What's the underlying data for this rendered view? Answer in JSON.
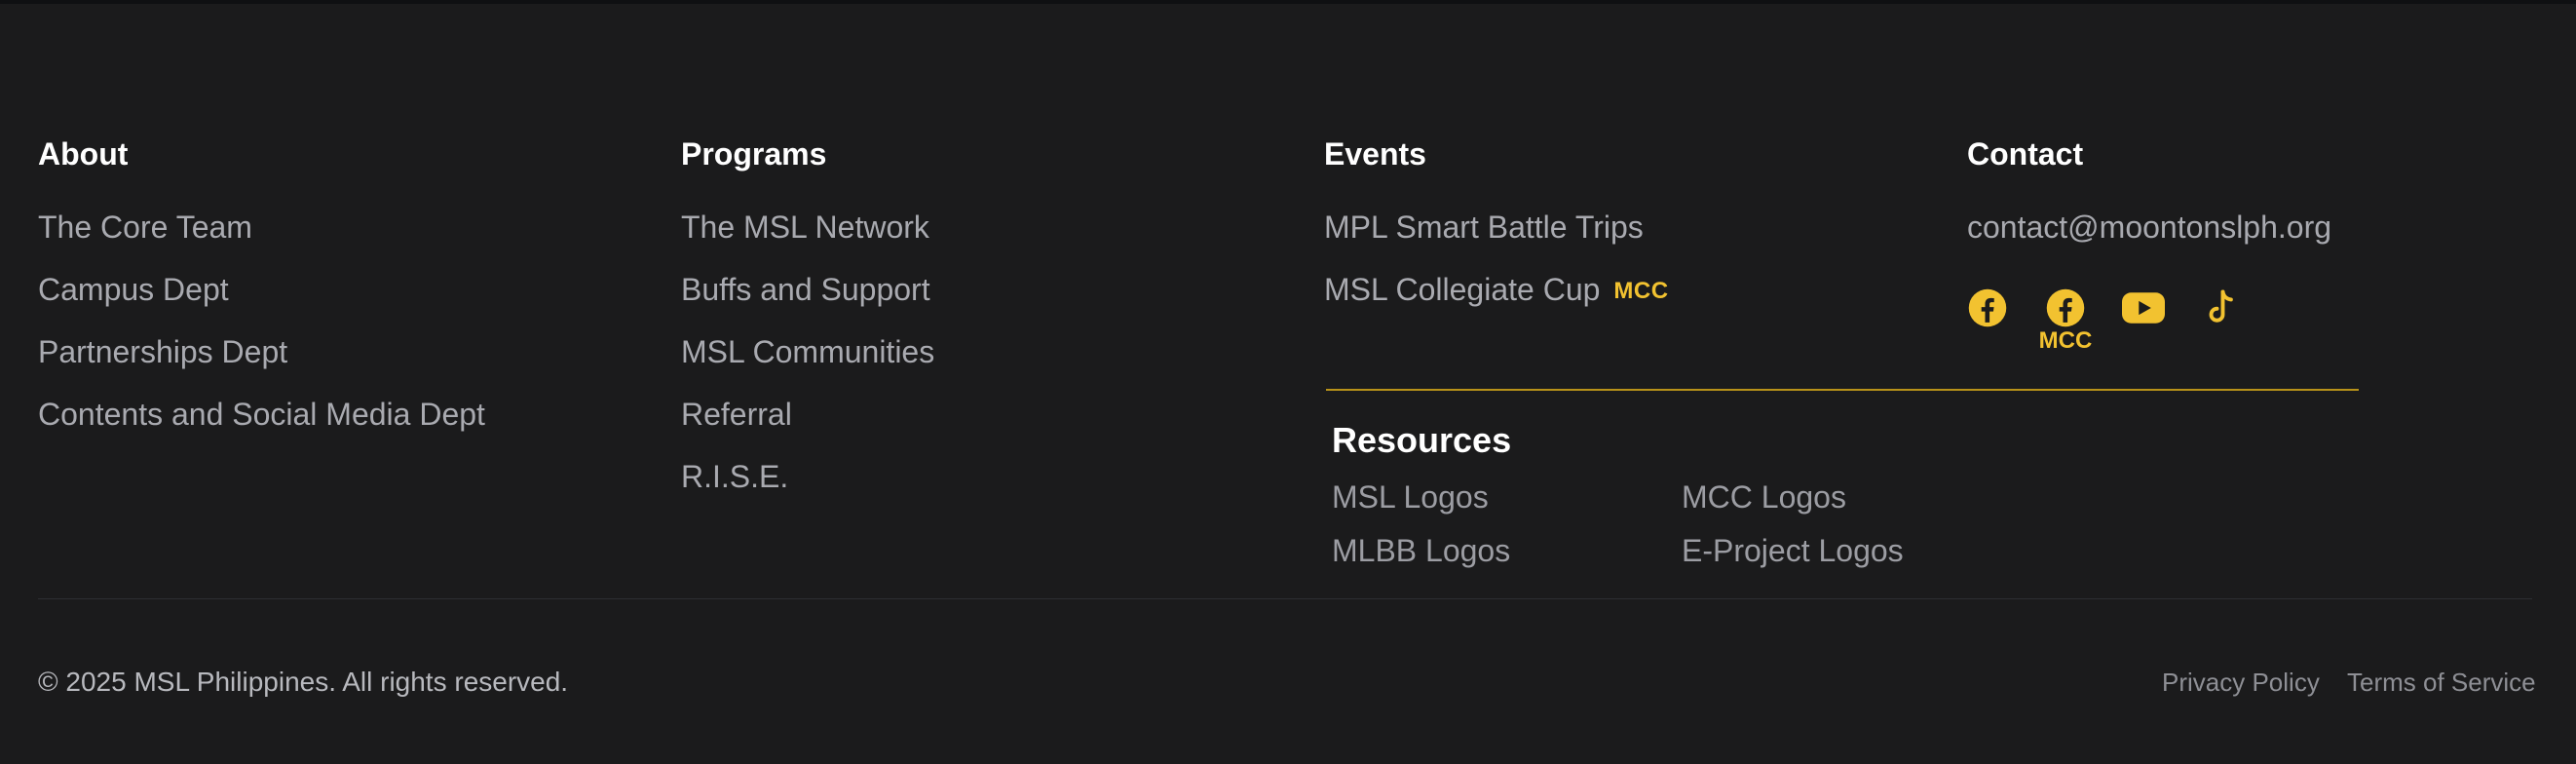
{
  "colors": {
    "accent": "#f2c230",
    "background": "#1b1b1c",
    "heading": "#ffffff",
    "link": "#a9aab0"
  },
  "about": {
    "heading": "About",
    "links": [
      "The Core Team",
      "Campus Dept",
      "Partnerships Dept",
      "Contents and Social Media Dept"
    ]
  },
  "programs": {
    "heading": "Programs",
    "links": [
      "The MSL Network",
      "Buffs and Support",
      "MSL Communities",
      "Referral",
      "R.I.S.E."
    ]
  },
  "events": {
    "heading": "Events",
    "links": [
      "MPL Smart Battle Trips",
      "MSL Collegiate Cup"
    ],
    "badge": "MCC"
  },
  "contact": {
    "heading": "Contact",
    "email": "contact@moontonslph.org",
    "socials": [
      {
        "icon": "facebook-icon",
        "label": ""
      },
      {
        "icon": "facebook-icon",
        "label": "MCC"
      },
      {
        "icon": "youtube-icon",
        "label": ""
      },
      {
        "icon": "tiktok-icon",
        "label": ""
      }
    ]
  },
  "resources": {
    "heading": "Resources",
    "links": [
      "MSL Logos",
      "MCC Logos",
      "MLBB Logos",
      "E-Project Logos"
    ]
  },
  "footer": {
    "copyright": "© 2025 MSL Philippines. All rights reserved.",
    "privacy": "Privacy Policy",
    "terms": "Terms of Service"
  }
}
